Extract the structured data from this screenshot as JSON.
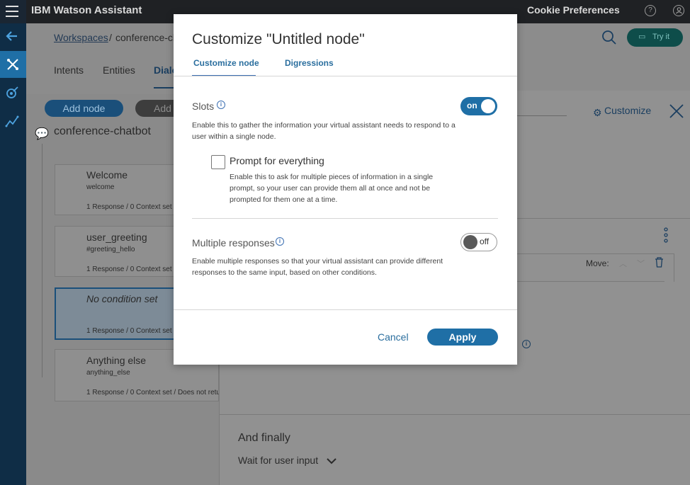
{
  "topbar": {
    "brand": "IBM Watson Assistant",
    "cookie": "Cookie Preferences",
    "help_icon": "?"
  },
  "breadcrumb": {
    "workspaces": "Workspaces",
    "separator": "/",
    "current": "conference-ch"
  },
  "nav_tabs": [
    "Intents",
    "Entities",
    "Dialo"
  ],
  "toolbar": {
    "add_node": "Add node",
    "add_child": "Add",
    "try_it": "Try it",
    "customize": "Customize"
  },
  "tree": {
    "root": "conference-chatbot",
    "nodes": [
      {
        "title": "Welcome",
        "condition": "welcome",
        "meta": "1 Response / 0 Context set"
      },
      {
        "title": "user_greeting",
        "condition": "#greeting_hello",
        "meta": "1 Response / 0 Context set"
      },
      {
        "title": "No condition set",
        "condition": "",
        "meta": "1 Response / 0 Context set"
      },
      {
        "title": "Anything else",
        "condition": "anything_else",
        "meta": "1 Response / 0 Context set / Does not retu"
      }
    ]
  },
  "editor": {
    "move_label": "Move:",
    "and_finally": "And finally",
    "wait": "Wait for user input"
  },
  "modal": {
    "title": "Customize \"Untitled node\"",
    "tabs": [
      "Customize node",
      "Digressions"
    ],
    "slots": {
      "title": "Slots",
      "toggle": "on",
      "desc": "Enable this to gather the information your virtual assistant needs to respond to a user within a single node."
    },
    "prompt": {
      "label": "Prompt for everything",
      "desc": "Enable this to ask for multiple pieces of information in a single prompt, so your user can provide them all at once and not be prompted for them one at a time."
    },
    "multiple": {
      "title": "Multiple responses",
      "toggle": "off",
      "desc": "Enable multiple responses so that your virtual assistant can provide different responses to the same input, based on other conditions."
    },
    "cancel": "Cancel",
    "apply": "Apply"
  },
  "colors": {
    "accent": "#1f6fa6",
    "rail": "#0f2d46",
    "topbar": "#1f2124"
  }
}
